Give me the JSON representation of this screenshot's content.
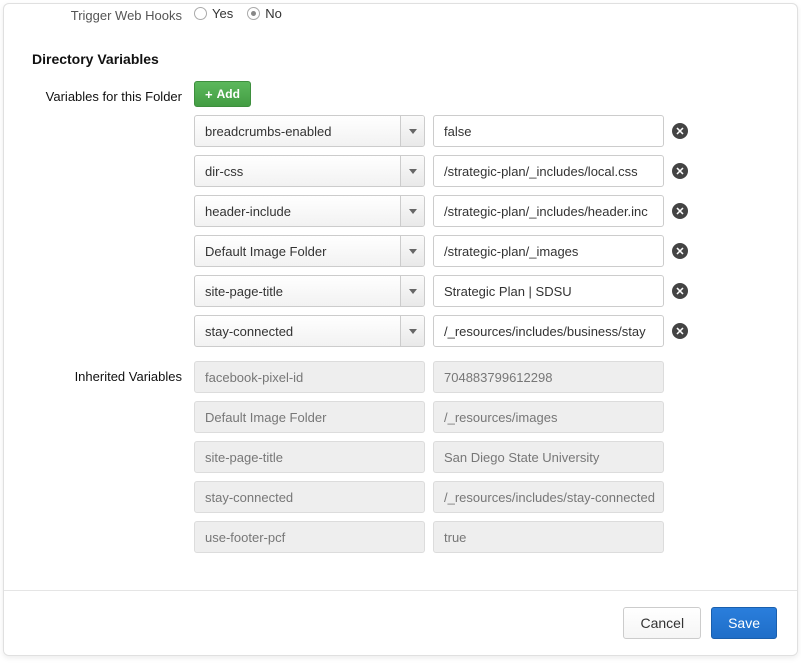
{
  "trigger": {
    "label": "Trigger Web Hooks",
    "yes_label": "Yes",
    "no_label": "No"
  },
  "section": {
    "heading": "Directory Variables",
    "folder_label": "Variables for this Folder",
    "add_label": "Add",
    "inherited_label": "Inherited Variables"
  },
  "folderVars": [
    {
      "name": "breadcrumbs-enabled",
      "value": "false"
    },
    {
      "name": "dir-css",
      "value": "/strategic-plan/_includes/local.css"
    },
    {
      "name": "header-include",
      "value": "/strategic-plan/_includes/header.inc"
    },
    {
      "name": "Default Image Folder",
      "value": "/strategic-plan/_images"
    },
    {
      "name": "site-page-title",
      "value": "Strategic Plan | SDSU"
    },
    {
      "name": "stay-connected",
      "value": "/_resources/includes/business/stay"
    }
  ],
  "inheritedVars": [
    {
      "name": "facebook-pixel-id",
      "value": "704883799612298"
    },
    {
      "name": "Default Image Folder",
      "value": "/_resources/images"
    },
    {
      "name": "site-page-title",
      "value": "San Diego State University"
    },
    {
      "name": "stay-connected",
      "value": "/_resources/includes/stay-connected"
    },
    {
      "name": "use-footer-pcf",
      "value": "true"
    }
  ],
  "footer": {
    "cancel": "Cancel",
    "save": "Save"
  }
}
